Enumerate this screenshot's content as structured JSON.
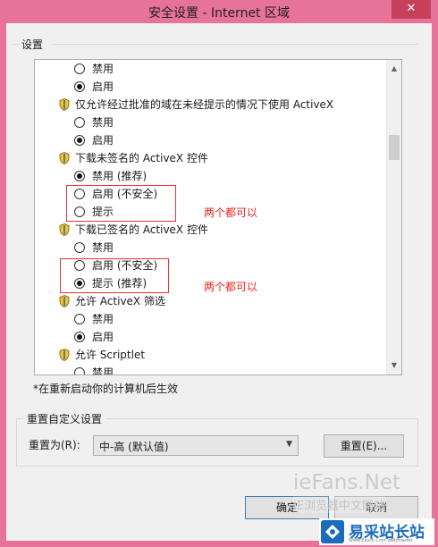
{
  "window": {
    "title": "安全设置 - Internet 区域",
    "close_glyph": "✕"
  },
  "settings": {
    "group_label": "设置",
    "items": [
      {
        "type": "radio",
        "label": "禁用",
        "checked": false
      },
      {
        "type": "radio",
        "label": "启用",
        "checked": true
      },
      {
        "type": "header",
        "label": "仅允许经过批准的域在未经提示的情况下使用 ActiveX"
      },
      {
        "type": "radio",
        "label": "禁用",
        "checked": false
      },
      {
        "type": "radio",
        "label": "启用",
        "checked": true
      },
      {
        "type": "header",
        "label": "下载未签名的 ActiveX 控件"
      },
      {
        "type": "radio",
        "label": "禁用 (推荐)",
        "checked": true
      },
      {
        "type": "radio",
        "label": "启用 (不安全)",
        "checked": false
      },
      {
        "type": "radio",
        "label": "提示",
        "checked": false
      },
      {
        "type": "header",
        "label": "下载已签名的 ActiveX 控件"
      },
      {
        "type": "radio",
        "label": "禁用",
        "checked": false
      },
      {
        "type": "radio",
        "label": "启用 (不安全)",
        "checked": false
      },
      {
        "type": "radio",
        "label": "提示 (推荐)",
        "checked": true
      },
      {
        "type": "header",
        "label": "允许 ActiveX 筛选"
      },
      {
        "type": "radio",
        "label": "禁用",
        "checked": false
      },
      {
        "type": "radio",
        "label": "启用",
        "checked": true
      },
      {
        "type": "header",
        "label": "允许 Scriptlet"
      },
      {
        "type": "radio",
        "label": "禁用",
        "checked": false
      }
    ],
    "scroll_up_glyph": "▲",
    "scroll_down_glyph": "▼"
  },
  "annotations": {
    "text_1": "两个都可以",
    "text_2": "两个都可以",
    "color": "#e22222"
  },
  "note": "*在重新启动你的计算机后生效",
  "reset": {
    "group_label": "重置自定义设置",
    "reset_to_label": "重置为(R):",
    "selected_value": "中-高 (默认值)",
    "dropdown_glyph": "▼",
    "reset_button": "重置(E)..."
  },
  "buttons": {
    "ok": "确定",
    "cancel": "取消"
  },
  "watermark": {
    "site": "ieFans.Net",
    "sub": "IE浏览器中文网站",
    "logo_text": "易采站长站",
    "logo_sub": "Www.Easck.Com Webmaster"
  },
  "colors": {
    "titlebar": "#e8739a",
    "accent": "#1b6dbb"
  }
}
